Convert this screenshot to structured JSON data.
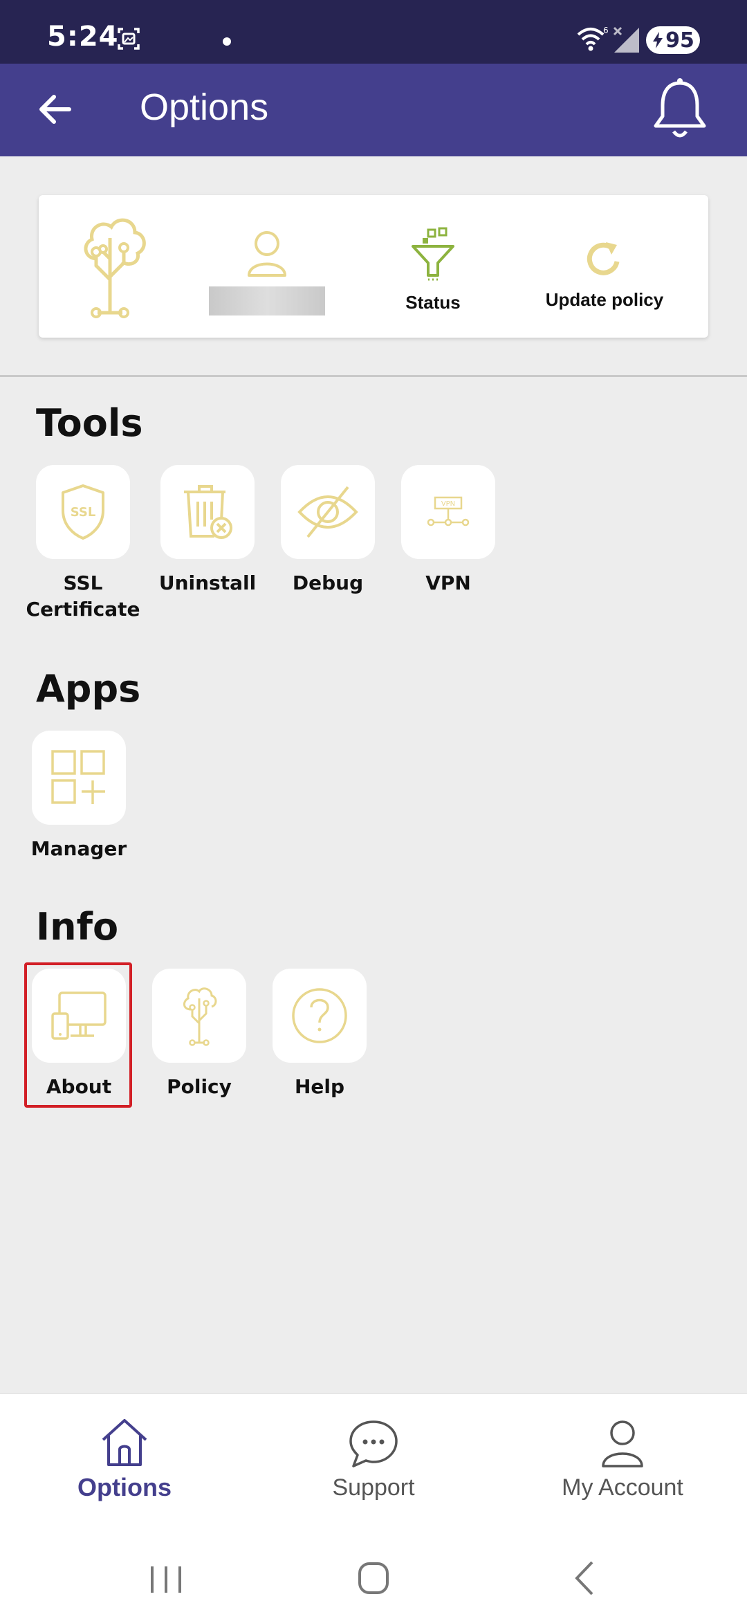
{
  "status_bar": {
    "time": "5:24",
    "battery": "95"
  },
  "app_bar": {
    "title": "Options"
  },
  "top_card": {
    "status_label": "Status",
    "update_label": "Update policy"
  },
  "sections": {
    "tools": {
      "title": "Tools",
      "items": [
        {
          "label": "SSL Certificate",
          "icon": "ssl-shield-icon"
        },
        {
          "label": "Uninstall",
          "icon": "trash-icon"
        },
        {
          "label": "Debug",
          "icon": "eye-off-icon"
        },
        {
          "label": "VPN",
          "icon": "vpn-icon"
        }
      ]
    },
    "apps": {
      "title": "Apps",
      "items": [
        {
          "label": "Manager",
          "icon": "apps-add-icon"
        }
      ]
    },
    "info": {
      "title": "Info",
      "items": [
        {
          "label": "About",
          "icon": "devices-icon"
        },
        {
          "label": "Policy",
          "icon": "tree-icon"
        },
        {
          "label": "Help",
          "icon": "question-icon"
        }
      ]
    }
  },
  "bottom_nav": {
    "items": [
      {
        "label": "Options",
        "active": true
      },
      {
        "label": "Support",
        "active": false
      },
      {
        "label": "My Account",
        "active": false
      }
    ]
  },
  "colors": {
    "status_bar": "#272452",
    "app_bar": "#443f8d",
    "icon_gold": "#e8d78e",
    "icon_green": "#8db33f",
    "highlight": "#d21f26"
  }
}
